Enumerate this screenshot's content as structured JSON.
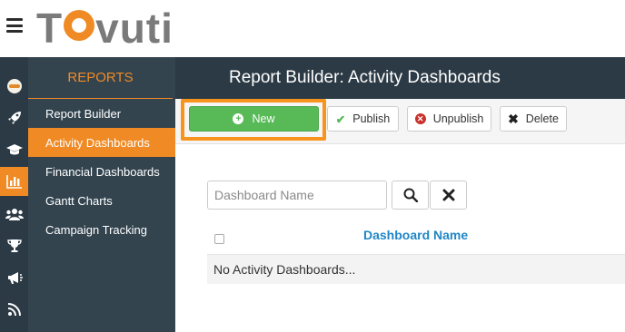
{
  "app": {
    "logo_text_left": "T",
    "logo_text_right": "vuti"
  },
  "iconbar": {
    "icons": [
      "avatar-icon",
      "rocket-icon",
      "graduation-cap-icon",
      "bar-chart-icon",
      "users-icon",
      "trophy-icon",
      "megaphone-icon",
      "signal-icon"
    ],
    "active_index": 3
  },
  "sidebar": {
    "title": "REPORTS",
    "items": [
      {
        "label": "Report Builder"
      },
      {
        "label": "Activity Dashboards",
        "active": true
      },
      {
        "label": "Financial Dashboards"
      },
      {
        "label": "Gantt Charts"
      },
      {
        "label": "Campaign Tracking"
      }
    ]
  },
  "header": {
    "title": "Report Builder: Activity Dashboards"
  },
  "toolbar": {
    "new_label": "New",
    "publish_label": "Publish",
    "unpublish_label": "Unpublish",
    "delete_label": "Delete"
  },
  "search": {
    "placeholder": "Dashboard Name",
    "value": ""
  },
  "table": {
    "columns": [
      "Dashboard Name"
    ],
    "empty_message": "No Activity Dashboards..."
  },
  "colors": {
    "accent": "#f08a24",
    "highlight": "#f7941d",
    "nav_dark": "#2b3a45",
    "sidebar": "#33444f",
    "success": "#58b957",
    "link": "#1f86c6",
    "danger": "#c9302c"
  }
}
